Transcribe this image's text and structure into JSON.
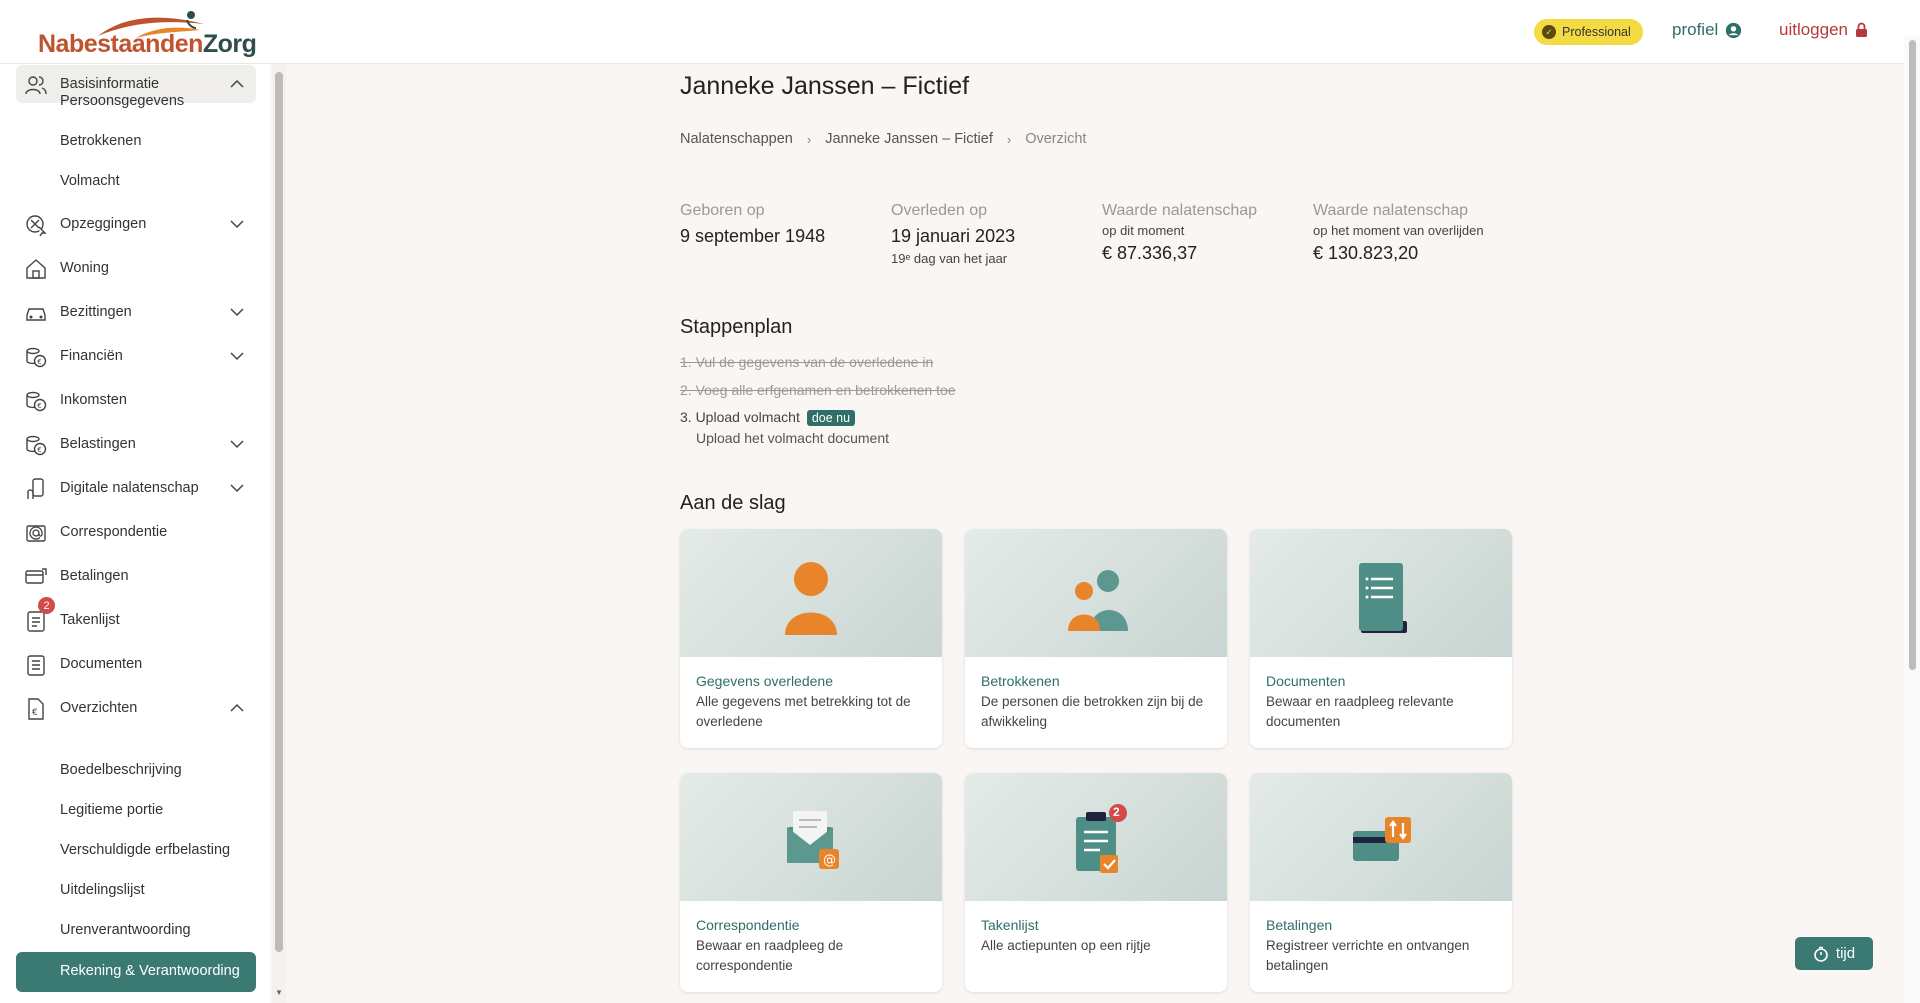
{
  "header": {
    "logo_part1": "Nabestaanden",
    "logo_part2": "Zorg",
    "badge": "Professional",
    "profile": "profiel",
    "logout": "uitloggen"
  },
  "sidebar": {
    "basis": "Basisinformatie",
    "basis_subs": [
      "Persoonsgegevens",
      "Betrokkenen",
      "Volmacht"
    ],
    "items": [
      "Opzeggingen",
      "Woning",
      "Bezittingen",
      "Financiën",
      "Inkomsten",
      "Belastingen",
      "Digitale nalatenschap",
      "Correspondentie",
      "Betalingen",
      "Takenlijst",
      "Documenten",
      "Overzichten"
    ],
    "takenlijst_badge": "2",
    "overzicht_subs": [
      "Boedelbeschrijving",
      "Legitieme portie",
      "Verschuldigde erfbelasting",
      "Uitdelingslijst",
      "Urenverantwoording"
    ],
    "active": "Rekening & Verantwoording"
  },
  "page": {
    "title": "Janneke Janssen – Fictief",
    "breadcrumb": [
      "Nalatenschappen",
      "Janneke Janssen – Fictief",
      "Overzicht"
    ],
    "stats": {
      "born_label": "Geboren op",
      "born_value": "9 september 1948",
      "died_label": "Overleden op",
      "died_value": "19 januari 2023",
      "died_sub": "19ᵉ dag van het jaar",
      "worth_now_label": "Waarde nalatenschap",
      "worth_now_sub": "op dit moment",
      "worth_now_value": "€ 87.336,37",
      "worth_death_label": "Waarde nalatenschap",
      "worth_death_sub": "op het moment van overlijden",
      "worth_death_value": "€ 130.823,20"
    },
    "stappenplan_title": "Stappenplan",
    "steps": [
      "1. Vul de gegevens van de overledene in",
      "2. Voeg alle erfgenamen en betrokkenen toe",
      "3. Upload volmacht"
    ],
    "step3_button": "doe nu",
    "step3_sub": "Upload het volmacht document",
    "aan_de_slag": "Aan de slag",
    "cards": [
      {
        "title": "Gegevens overledene",
        "desc": "Alle gegevens met betrekking tot de overledene"
      },
      {
        "title": "Betrokkenen",
        "desc": "De personen die betrokken zijn bij de afwikkeling"
      },
      {
        "title": "Documenten",
        "desc": "Bewaar en raadpleeg relevante documenten"
      },
      {
        "title": "Correspondentie",
        "desc": "Bewaar en raadpleeg de correspondentie"
      },
      {
        "title": "Takenlijst",
        "desc": "Alle actiepunten op een rijtje"
      },
      {
        "title": "Betalingen",
        "desc": "Registreer verrichte en ontvangen betalingen"
      }
    ],
    "takenlijst_card_badge": "2"
  },
  "tijd_button": "tijd",
  "colors": {
    "accent": "#3a7a72",
    "badge": "#f4da43",
    "logout": "#b83a3a",
    "orange": "#e8852a"
  }
}
